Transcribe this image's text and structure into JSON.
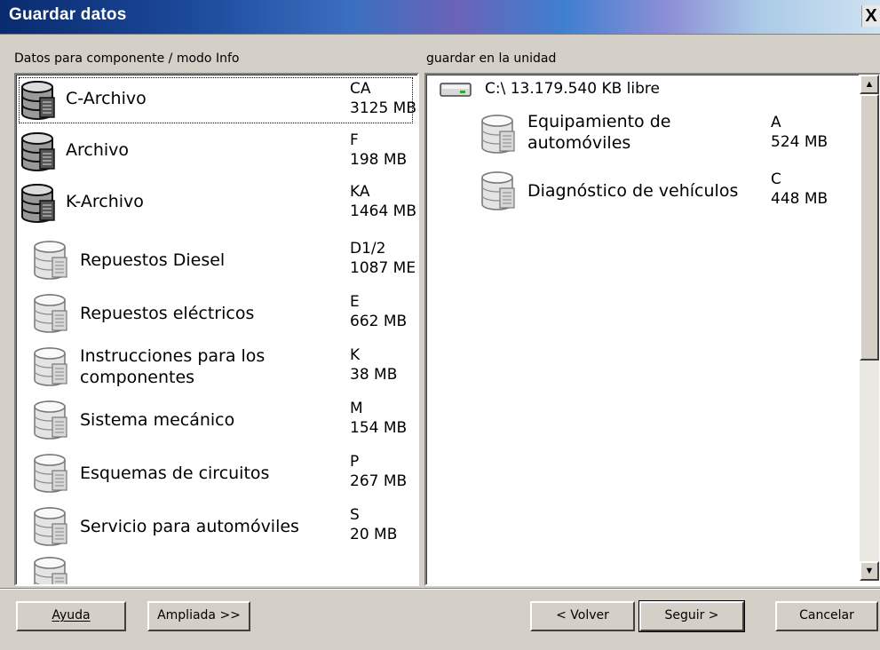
{
  "window": {
    "title": "Guardar datos",
    "close_label": "X"
  },
  "left": {
    "label": "Datos para componente / modo Info",
    "items": [
      {
        "name": "C-Archivo",
        "code": "CA",
        "size": "3125 MB",
        "icon": "database-dark-icon"
      },
      {
        "name": "Archivo",
        "code": "F",
        "size": "198 MB",
        "icon": "database-dark-icon"
      },
      {
        "name": "K-Archivo",
        "code": "KA",
        "size": "1464 MB",
        "icon": "database-dark-icon"
      },
      {
        "name": "Repuestos Diesel",
        "code": "D1/2",
        "size": "1087 ME",
        "icon": "database-icon"
      },
      {
        "name": "Repuestos eléctricos",
        "code": "E",
        "size": "662 MB",
        "icon": "database-icon"
      },
      {
        "name": "Instrucciones para los",
        "name2": "componentes",
        "code": "K",
        "size": "38 MB",
        "icon": "database-icon"
      },
      {
        "name": "Sistema mecánico",
        "code": "M",
        "size": "154 MB",
        "icon": "database-icon"
      },
      {
        "name": "Esquemas de circuitos",
        "code": "P",
        "size": "267 MB",
        "icon": "database-icon"
      },
      {
        "name": "Servicio para automóviles",
        "code": "S",
        "size": "20 MB",
        "icon": "database-icon"
      }
    ]
  },
  "right": {
    "label": "guardar en la unidad",
    "drive": "C:\\ 13.179.540 KB libre",
    "items": [
      {
        "name": "Equipamiento de",
        "name2": "automóviles",
        "code": "A",
        "size": "524 MB"
      },
      {
        "name": "Diagnóstico de vehículos",
        "code": "C",
        "size": "448 MB"
      }
    ]
  },
  "buttons": {
    "help": "Ayuda",
    "expanded": "Ampliada >>",
    "back": "< Volver",
    "next": "Seguir >",
    "cancel": "Cancelar"
  }
}
